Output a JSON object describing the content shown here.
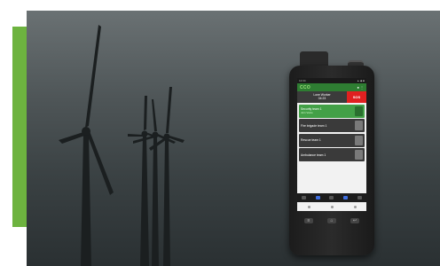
{
  "colors": {
    "accent_bar": "#6db33f",
    "sky_top": "#6a7173",
    "sky_bottom": "#2a3032",
    "app_bar": "#2e7d32",
    "sos": "#e02020",
    "team_active": "#43a047",
    "team_inactive": "#3a3a3a"
  },
  "phone": {
    "status_left": "12:34",
    "status_right": "▲ ◆ ■",
    "app_logo": "CCO",
    "app_bar_icons": "● ⋮",
    "worker_label": "Lone Worker",
    "worker_value": "04:23",
    "sos_label": "SOS",
    "teams": [
      {
        "name": "Security team 1",
        "sub": "Join Voice",
        "active": true
      },
      {
        "name": "Fire brigade team 1",
        "sub": "",
        "active": false
      },
      {
        "name": "Rescue team 1",
        "sub": "",
        "active": false
      },
      {
        "name": "Ambulance team 1",
        "sub": "",
        "active": false
      }
    ],
    "keys": [
      "≡",
      "⌂",
      "↩"
    ]
  }
}
